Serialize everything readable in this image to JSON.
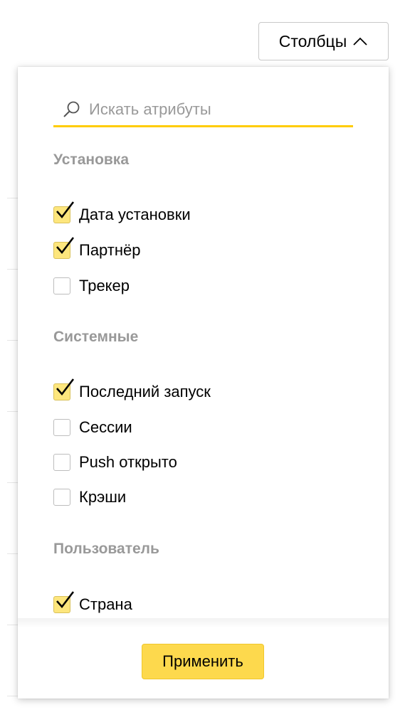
{
  "toolbar": {
    "columns_label": "Столбцы",
    "columns_icon": "chevron-up-icon"
  },
  "search": {
    "placeholder": "Искать атрибуты",
    "value": "",
    "icon": "search-icon",
    "accent_color": "#ffcc00"
  },
  "groups": [
    {
      "title": "Установка",
      "items": [
        {
          "label": "Дата установки",
          "checked": true
        },
        {
          "label": "Партнёр",
          "checked": true
        },
        {
          "label": "Трекер",
          "checked": false
        }
      ]
    },
    {
      "title": "Системные",
      "items": [
        {
          "label": "Последний запуск",
          "checked": true
        },
        {
          "label": "Сессии",
          "checked": false
        },
        {
          "label": "Push открыто",
          "checked": false
        },
        {
          "label": "Крэши",
          "checked": false
        }
      ]
    },
    {
      "title": "Пользователь",
      "items": [
        {
          "label": "Страна",
          "checked": true
        }
      ]
    }
  ],
  "footer": {
    "apply_label": "Применить",
    "apply_color": "#fdd94d"
  },
  "colors": {
    "checkbox_checked": "#fde67d",
    "group_title": "#999999"
  }
}
